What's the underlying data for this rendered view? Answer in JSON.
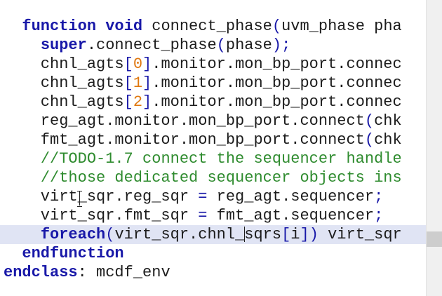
{
  "editor": {
    "lines": [
      {
        "tokens": [
          {
            "t": "  ",
            "c": "txt"
          },
          {
            "t": "function",
            "c": "kw"
          },
          {
            "t": " ",
            "c": "txt"
          },
          {
            "t": "void",
            "c": "kw"
          },
          {
            "t": " connect_phase",
            "c": "txt"
          },
          {
            "t": "(",
            "c": "op"
          },
          {
            "t": "uvm_phase pha",
            "c": "txt"
          }
        ]
      },
      {
        "tokens": [
          {
            "t": "    ",
            "c": "txt"
          },
          {
            "t": "super",
            "c": "kw"
          },
          {
            "t": ".connect_phase",
            "c": "txt"
          },
          {
            "t": "(",
            "c": "op"
          },
          {
            "t": "phase",
            "c": "txt"
          },
          {
            "t": ");",
            "c": "op"
          }
        ]
      },
      {
        "tokens": [
          {
            "t": "    chnl_agts",
            "c": "txt"
          },
          {
            "t": "[",
            "c": "op"
          },
          {
            "t": "0",
            "c": "num"
          },
          {
            "t": "]",
            "c": "op"
          },
          {
            "t": ".monitor.mon_bp_port.connec",
            "c": "txt"
          }
        ]
      },
      {
        "tokens": [
          {
            "t": "    chnl_agts",
            "c": "txt"
          },
          {
            "t": "[",
            "c": "op"
          },
          {
            "t": "1",
            "c": "num"
          },
          {
            "t": "]",
            "c": "op"
          },
          {
            "t": ".monitor.mon_bp_port.connec",
            "c": "txt"
          }
        ]
      },
      {
        "tokens": [
          {
            "t": "    chnl_agts",
            "c": "txt"
          },
          {
            "t": "[",
            "c": "op"
          },
          {
            "t": "2",
            "c": "num"
          },
          {
            "t": "]",
            "c": "op"
          },
          {
            "t": ".monitor.mon_bp_port.connec",
            "c": "txt"
          }
        ]
      },
      {
        "tokens": [
          {
            "t": "    reg_agt.monitor.mon_bp_port.connect",
            "c": "txt"
          },
          {
            "t": "(",
            "c": "op"
          },
          {
            "t": "chk",
            "c": "txt"
          }
        ]
      },
      {
        "tokens": [
          {
            "t": "    fmt_agt.monitor.mon_bp_port.connect",
            "c": "txt"
          },
          {
            "t": "(",
            "c": "op"
          },
          {
            "t": "chk",
            "c": "txt"
          }
        ]
      },
      {
        "tokens": [
          {
            "t": "    ",
            "c": "txt"
          },
          {
            "t": "//TODO-1.7 connect the sequencer handle",
            "c": "cm"
          }
        ]
      },
      {
        "tokens": [
          {
            "t": "    ",
            "c": "txt"
          },
          {
            "t": "//those dedicated sequencer objects ins",
            "c": "cm"
          }
        ]
      },
      {
        "tokens": [
          {
            "t": "    virt_sqr.reg_sqr ",
            "c": "txt"
          },
          {
            "t": "=",
            "c": "op"
          },
          {
            "t": " reg_agt.sequencer",
            "c": "txt"
          },
          {
            "t": ";",
            "c": "op"
          }
        ]
      },
      {
        "tokens": [
          {
            "t": "    virt_sqr.fmt_sqr ",
            "c": "txt"
          },
          {
            "t": "=",
            "c": "op"
          },
          {
            "t": " fmt_agt.sequencer",
            "c": "txt"
          },
          {
            "t": ";",
            "c": "op"
          }
        ]
      },
      {
        "current": true,
        "tokens": [
          {
            "t": "    ",
            "c": "txt"
          },
          {
            "t": "foreach",
            "c": "kw"
          },
          {
            "t": "(",
            "c": "op"
          },
          {
            "t": "virt_sqr.chnl_",
            "c": "txt"
          },
          {
            "caret": true
          },
          {
            "t": "sqrs",
            "c": "txt"
          },
          {
            "t": "[",
            "c": "op"
          },
          {
            "t": "i",
            "c": "txt"
          },
          {
            "t": "])",
            "c": "op"
          },
          {
            "t": " virt_sqr",
            "c": "txt"
          }
        ]
      },
      {
        "tokens": [
          {
            "t": "  ",
            "c": "txt"
          },
          {
            "t": "endfunction",
            "c": "kw"
          }
        ]
      },
      {
        "tokens": [
          {
            "t": "endclass",
            "c": "kw"
          },
          {
            "t": ": mcdf_env",
            "c": "txt"
          }
        ]
      }
    ]
  },
  "colors": {
    "background": "#ffffff",
    "keyword": "#1818a8",
    "number": "#e07810",
    "comment": "#2e8b2e",
    "text": "#1c1c1c",
    "current_line": "#e0e4f4"
  },
  "icons": {
    "mouse_cursor": "text-ibeam-cursor-icon"
  }
}
